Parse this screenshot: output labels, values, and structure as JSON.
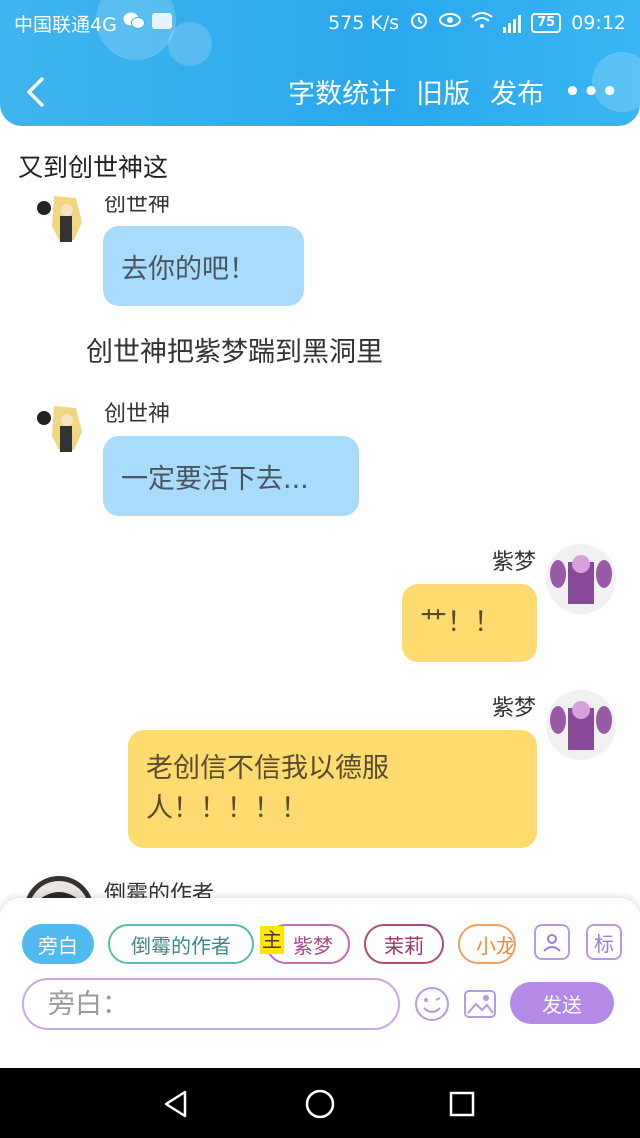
{
  "status_bar": {
    "carrier": "中国联通4G",
    "speed": "575 K/s",
    "battery": "75",
    "network": "4G",
    "time": "09:12"
  },
  "nav": {
    "back_icon": "chevron-left-icon",
    "word_count": "字数统计",
    "old_version": "旧版",
    "publish": "发布",
    "more": "•••"
  },
  "story": {
    "title": "又到创世神这"
  },
  "messages": [
    {
      "side": "left",
      "speaker": "创世神",
      "text": "去你的吧！",
      "style": "blue"
    },
    {
      "side": "narration",
      "text": "创世神把紫梦踹到黑洞里"
    },
    {
      "side": "left",
      "speaker": "创世神",
      "text": "一定要活下去...",
      "style": "blue"
    },
    {
      "side": "right",
      "speaker": "紫梦",
      "text": "艹！！",
      "style": "yellow"
    },
    {
      "side": "right",
      "speaker": "紫梦",
      "text_line1": "老创信不信我以德服",
      "text_line2": "人！！！！！",
      "style": "yellow"
    },
    {
      "side": "left",
      "speaker": "倒霉的作者"
    }
  ],
  "roles": {
    "narrator": "旁白",
    "chips": [
      "倒霉的作者",
      "紫梦",
      "茉莉",
      "小龙"
    ],
    "host_tag": "主",
    "profile_icon": "profile-icon",
    "tag_button": "标"
  },
  "input": {
    "placeholder": "旁白：",
    "emoji_icon": "emoji-icon",
    "image_icon": "image-icon",
    "send": "发送"
  },
  "colors": {
    "header": "#2aa8ee",
    "bubble_blue": "#a9dbfa",
    "bubble_yellow": "#fddb6e",
    "send": "#b48ae6"
  }
}
